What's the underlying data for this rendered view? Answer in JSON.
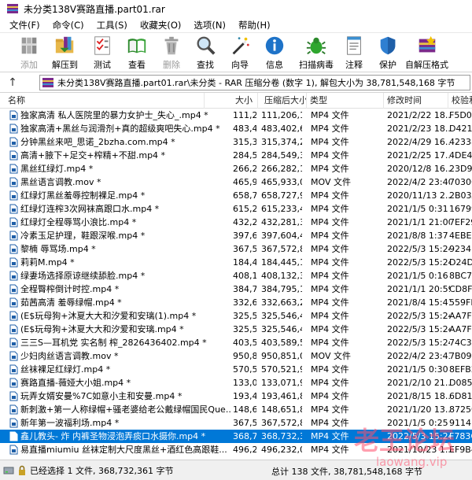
{
  "window": {
    "title": "未分类138V赛路直播.part01.rar"
  },
  "menu": [
    "文件(F)",
    "命令(C)",
    "工具(S)",
    "收藏夹(O)",
    "选项(N)",
    "帮助(H)"
  ],
  "toolbar": [
    {
      "id": "add",
      "label": "添加",
      "icon": "books-icon",
      "disabled": true
    },
    {
      "id": "extract",
      "label": "解压到",
      "icon": "folder-extract-icon",
      "disabled": false
    },
    {
      "id": "test",
      "label": "测试",
      "icon": "checklist-icon",
      "disabled": false
    },
    {
      "id": "view",
      "label": "查看",
      "icon": "book-view-icon",
      "disabled": false
    },
    {
      "id": "delete",
      "label": "删除",
      "icon": "trash-icon",
      "disabled": true
    },
    {
      "id": "find",
      "label": "查找",
      "icon": "magnifier-icon",
      "disabled": false
    },
    {
      "id": "wizard",
      "label": "向导",
      "icon": "wand-icon",
      "disabled": false
    },
    {
      "id": "info",
      "label": "信息",
      "icon": "info-icon",
      "disabled": false
    },
    {
      "id": "virus",
      "label": "扫描病毒",
      "icon": "bug-icon",
      "disabled": false
    },
    {
      "id": "comment",
      "label": "注释",
      "icon": "notepad-icon",
      "disabled": false
    },
    {
      "id": "protect",
      "label": "保护",
      "icon": "shield-icon",
      "disabled": false
    },
    {
      "id": "sfx",
      "label": "自解压格式",
      "icon": "sfx-box-icon",
      "disabled": false
    }
  ],
  "address": {
    "text": "未分类138V赛路直播.part01.rar\\未分类 - RAR 压缩分卷 (数字 1), 解包大小为 38,781,548,168 字节"
  },
  "columns": [
    "名称",
    "大小",
    "压缩后大小",
    "类型",
    "修改时间",
    "校验和"
  ],
  "files": [
    {
      "name": "独家高清 私人医院里的暴力女护士_失心_.mp4 *",
      "size": "111,206,1...",
      "packed": "111,206,1...",
      "type": "MP4 文件",
      "modified": "2021/2/22 18...",
      "crc": "F5D0E"
    },
    {
      "name": "独家高清+黑丝与润滑剂+真的超级爽吧失心.mp4 *",
      "size": "483,402,6...",
      "packed": "483,402,6...",
      "type": "MP4 文件",
      "modified": "2021/2/23 18...",
      "crc": "D4218"
    },
    {
      "name": "分钟黑丝来吧_思诺_2bzha.com.mp4 *",
      "size": "315,374,2...",
      "packed": "315,374,2...",
      "type": "MP4 文件",
      "modified": "2022/4/29 16...",
      "crc": "42338"
    },
    {
      "name": "高清+腋下+足交+榨精+不甜.mp4 *",
      "size": "284,549,3...",
      "packed": "284,549,3...",
      "type": "MP4 文件",
      "modified": "2021/2/25 17...",
      "crc": "4DE4A"
    },
    {
      "name": "黑丝红绿灯.mp4 *",
      "size": "266,282,1...",
      "packed": "266,282,1...",
      "type": "MP4 文件",
      "modified": "2020/12/8 16...",
      "crc": "23D9E"
    },
    {
      "name": "黑丝语言调教.mov *",
      "size": "465,933,0...",
      "packed": "465,933,0...",
      "type": "MOV 文件",
      "modified": "2022/4/2 23:40",
      "crc": "70306"
    },
    {
      "name": "红绿灯黑丝羞辱控制裸足.mp4 *",
      "size": "658,727,9...",
      "packed": "658,727,9...",
      "type": "MP4 文件",
      "modified": "2020/11/13 2...",
      "crc": "2B03A"
    },
    {
      "name": "红绿灯连榨3次网袜高跟口水.mp4 *",
      "size": "615,233,4...",
      "packed": "615,233,4...",
      "type": "MP4 文件",
      "modified": "2021/1/5 0:31",
      "crc": "16799"
    },
    {
      "name": "红绿灯全程辱骂小浪比.mp4 *",
      "size": "432,281,3...",
      "packed": "432,281,3...",
      "type": "MP4 文件",
      "modified": "2021/1/1 21:00",
      "crc": "7EF29"
    },
    {
      "name": "冷素玉足护理，鞋跟深喉.mp4 *",
      "size": "397,604,4...",
      "packed": "397,604,4...",
      "type": "MP4 文件",
      "modified": "2021/8/8 1:37",
      "crc": "4EBEE"
    },
    {
      "name": "黎楠 辱骂场.mp4 *",
      "size": "367,572,8...",
      "packed": "367,572,8...",
      "type": "MP4 文件",
      "modified": "2022/5/3 15:24",
      "crc": "9234B"
    },
    {
      "name": "莉莉M.mp4 *",
      "size": "184,445,1...",
      "packed": "184,445,1...",
      "type": "MP4 文件",
      "modified": "2022/5/3 15:24",
      "crc": "D24D5"
    },
    {
      "name": "绿妻场选择原谅继续舔脸.mp4 *",
      "size": "408,132,3...",
      "packed": "408,132,3...",
      "type": "MP4 文件",
      "modified": "2021/1/5 0:16",
      "crc": "8BC76"
    },
    {
      "name": "全程臀榨倒计时控.mp4 *",
      "size": "384,795,1...",
      "packed": "384,795,1...",
      "type": "MP4 文件",
      "modified": "2021/1/1 20:59",
      "crc": "CD8F2"
    },
    {
      "name": "茹茜高清 羞辱绿帽.mp4 *",
      "size": "332,663,2...",
      "packed": "332,663,2...",
      "type": "MP4 文件",
      "modified": "2021/8/4 15:41",
      "crc": "559FF"
    },
    {
      "name": "(E$玩母狗+沐夏大大和汐爱和安璃(1).mp4 *",
      "size": "325,546,4...",
      "packed": "325,546,4...",
      "type": "MP4 文件",
      "modified": "2022/5/3 15:24",
      "crc": "AA7FE"
    },
    {
      "name": "(E$玩母狗+沐夏大大和汐爱和安璃.mp4 *",
      "size": "325,546,4...",
      "packed": "325,546,4...",
      "type": "MP4 文件",
      "modified": "2022/5/3 15:24",
      "crc": "AA7FE"
    },
    {
      "name": "三三S—耳机党 实名制 榨_2826436402.mp4 *",
      "size": "403,589,5...",
      "packed": "403,589,5...",
      "type": "MP4 文件",
      "modified": "2022/5/3 15:24",
      "crc": "74C36"
    },
    {
      "name": "少妇肉丝语言调教.mov *",
      "size": "950,851,0...",
      "packed": "950,851,0...",
      "type": "MOV 文件",
      "modified": "2022/4/2 23:43",
      "crc": "7B095"
    },
    {
      "name": "丝袜裸足红绿灯.mp4 *",
      "size": "570,521,9...",
      "packed": "570,521,9...",
      "type": "MP4 文件",
      "modified": "2021/1/5 0:30",
      "crc": "8EFB2"
    },
    {
      "name": "赛路直播-薇娅大小姐.mp4 *",
      "size": "133,071,9...",
      "packed": "133,071,9...",
      "type": "MP4 文件",
      "modified": "2021/2/10 21...",
      "crc": "D085A"
    },
    {
      "name": "玩弄女婿安曼%7C如意小主和安曼.mp4 *",
      "size": "193,461,8...",
      "packed": "193,461,8...",
      "type": "MP4 文件",
      "modified": "2021/8/15 18...",
      "crc": "6D812"
    },
    {
      "name": "新刺激+第一人称绿帽+骚老婆给老公戴绿帽国民Que...",
      "size": "148,651,8...",
      "packed": "148,651,8...",
      "type": "MP4 文件",
      "modified": "2021/1/20 13...",
      "crc": "87250"
    },
    {
      "name": "新年第一波福利场.mp4 *",
      "size": "367,572,8...",
      "packed": "367,572,8...",
      "type": "MP4 文件",
      "modified": "2021/1/5 0:25",
      "crc": "9114B"
    },
    {
      "name": "鑫儿教头- 炸 内裤圣物浸泡弄痰口水摄你.mp4 *",
      "size": "368,732,3...",
      "packed": "368,732,3...",
      "type": "MP4 文件",
      "modified": "2022/5/3 15:24",
      "crc": "F783C",
      "selected": true
    },
    {
      "name": "易直播miumiu 丝袜定制大尺度黑丝+酒红色高跟鞋...",
      "size": "496,232,0...",
      "packed": "496,232,0...",
      "type": "MP4 文件",
      "modified": "2021/10/23 1...",
      "crc": "EF9B4"
    }
  ],
  "status": {
    "left": "已经选择 1 文件, 368,732,361 字节",
    "right": "总计 138 文件, 38,781,548,168 字节"
  },
  "watermark": {
    "main": "老王论坛",
    "sub": "laowang.vip"
  }
}
